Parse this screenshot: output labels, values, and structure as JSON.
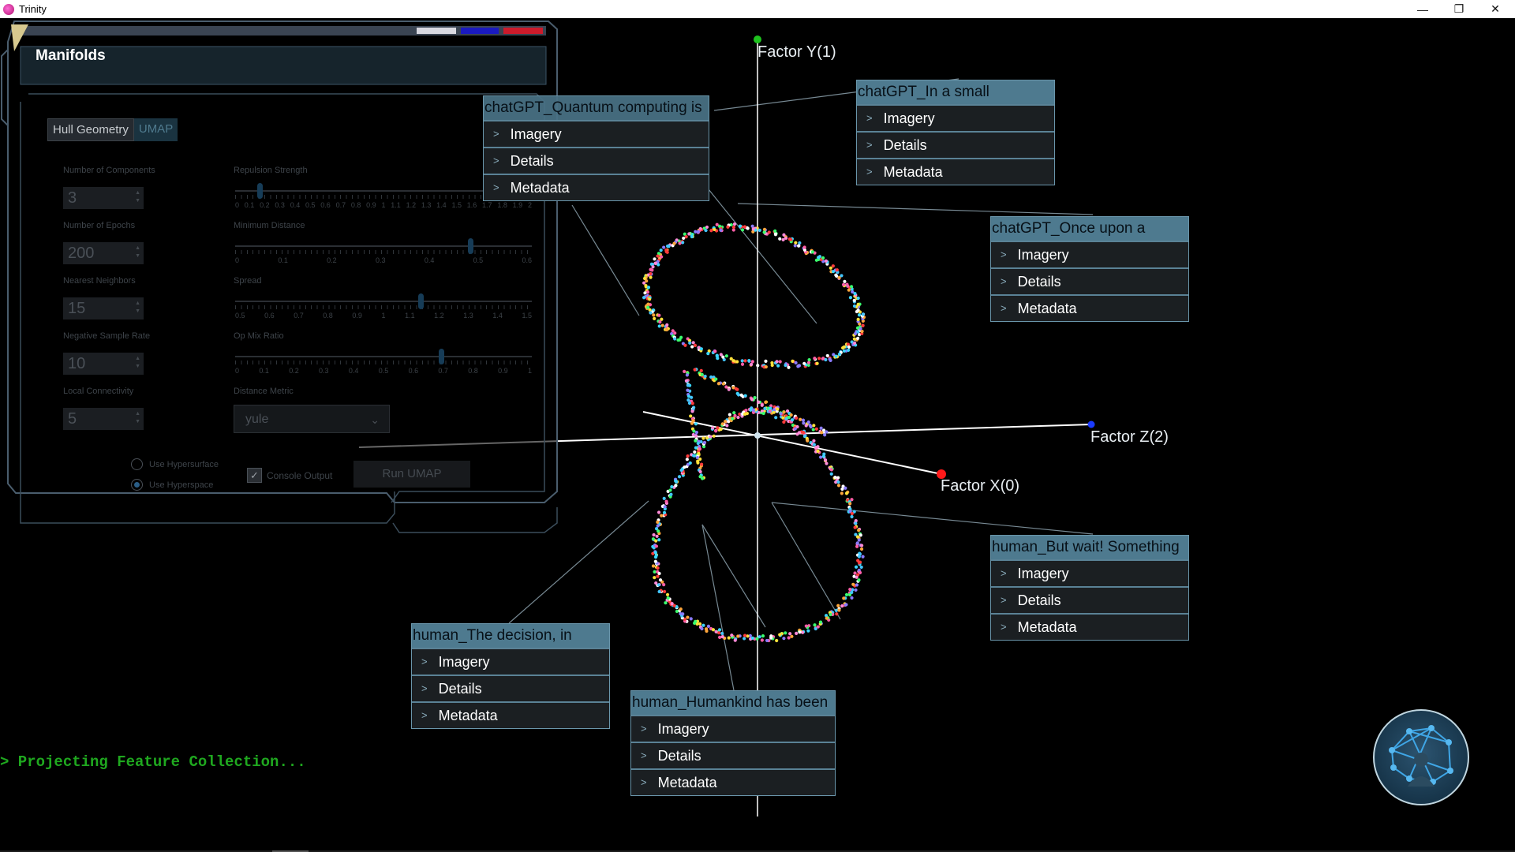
{
  "window": {
    "title": "Trinity",
    "controls": [
      "—",
      "❐",
      "✕"
    ]
  },
  "panel": {
    "title": "Manifolds",
    "header_colors": [
      "#d8d8e0",
      "#1a1ac0",
      "#cc1b2b"
    ],
    "tabs": [
      {
        "label": "Hull Geometry"
      },
      {
        "label": "UMAP"
      }
    ],
    "fields": [
      {
        "label": "Number of Components",
        "value": "3"
      },
      {
        "label": "Number of Epochs",
        "value": "200"
      },
      {
        "label": "Nearest Neighbors",
        "value": "15"
      },
      {
        "label": "Negative Sample Rate",
        "value": "10"
      },
      {
        "label": "Local Connectivity",
        "value": "5"
      }
    ],
    "sliders": [
      {
        "label": "Repulsion Strength",
        "ticks": [
          "0",
          "0.1",
          "0.2",
          "0.3",
          "0.4",
          "0.5",
          "0.6",
          "0.7",
          "0.8",
          "0.9",
          "1",
          "1.1",
          "1.2",
          "1.3",
          "1.4",
          "1.5",
          "1.6",
          "1.7",
          "1.8",
          "1.9",
          "2"
        ],
        "value": 0.15,
        "min": 0,
        "max": 2
      },
      {
        "label": "Minimum Distance",
        "ticks": [
          "0",
          "0.1",
          "0.2",
          "0.3",
          "0.4",
          "0.5",
          "0.6"
        ],
        "value": 0.48,
        "min": 0,
        "max": 0.6
      },
      {
        "label": "Spread",
        "ticks": [
          "0.5",
          "0.6",
          "0.7",
          "0.8",
          "0.9",
          "1",
          "1.1",
          "1.2",
          "1.3",
          "1.4",
          "1.5"
        ],
        "value": 1.13,
        "min": 0.5,
        "max": 1.5
      },
      {
        "label": "Op Mix Ratio",
        "ticks": [
          "0",
          "0.1",
          "0.2",
          "0.3",
          "0.4",
          "0.5",
          "0.6",
          "0.7",
          "0.8",
          "0.9",
          "1"
        ],
        "value": 0.7,
        "min": 0,
        "max": 1
      }
    ],
    "distance_metric": {
      "label": "Distance Metric",
      "value": "yule"
    },
    "radios": [
      {
        "label": "Use Hypersurface",
        "selected": false
      },
      {
        "label": "Use Hyperspace",
        "selected": true
      }
    ],
    "console_output": {
      "label": "Console Output",
      "checked": true
    },
    "run_button": "Run UMAP"
  },
  "axes": {
    "y_label": "Factor Y(1)",
    "z_label": "Factor Z(2)",
    "x_label": "Factor X(0)"
  },
  "feature_windows": [
    {
      "title": "chatGPT_Quantum computing is",
      "items": [
        "Imagery",
        "Details",
        "Metadata"
      ]
    },
    {
      "title": "chatGPT_In a small",
      "items": [
        "Imagery",
        "Details",
        "Metadata"
      ]
    },
    {
      "title": "chatGPT_Once upon a",
      "items": [
        "Imagery",
        "Details",
        "Metadata"
      ]
    },
    {
      "title": "human_But wait! Something",
      "items": [
        "Imagery",
        "Details",
        "Metadata"
      ]
    },
    {
      "title": "human_The decision, in",
      "items": [
        "Imagery",
        "Details",
        "Metadata"
      ]
    },
    {
      "title": "human_Humankind has been",
      "items": [
        "Imagery",
        "Details",
        "Metadata"
      ]
    }
  ],
  "console": "> Projecting Feature Collection..."
}
